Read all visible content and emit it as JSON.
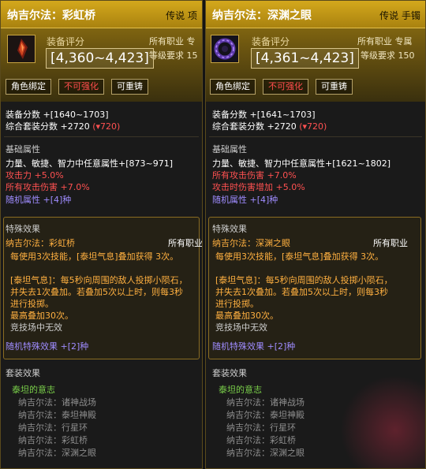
{
  "panel_left": {
    "title": "纳吉尔法：彩虹桥",
    "grade": "传说 项",
    "score_label": "装备评分",
    "score": "[4,360~4,423]",
    "class_req": "所有职业 专",
    "level_req": "等级要求 15",
    "icon": "red-shard-icon",
    "tags": [
      "角色绑定",
      "不可强化",
      "可重铸"
    ],
    "equip_score": "装备分数 +[1640~1703]",
    "set_score_prefix": "综合套装分数 +2720",
    "set_score_delta": "(▾720)",
    "base_attr_title": "基础属性",
    "base_attrs": [
      "力量、敏捷、智力中任意属性+[873~971]",
      "攻击力 +5.0%",
      "所有攻击伤害 +7.0%",
      "随机属性 +[4]种"
    ],
    "special_title": "特殊效果",
    "special_name": "纳吉尔法：彩虹桥",
    "special_class": "所有职业",
    "special_lines": [
      "每使用3次技能，[泰坦气息]叠加获得 3次。",
      "[泰坦气息]：每5秒向周围的敌人投掷小陨石，",
      "并失去1次叠加。若叠加5次以上时，则每3秒",
      "进行投掷。",
      "最高叠加30次。",
      "竞技场中无效"
    ],
    "special_random": "随机特殊效果 +[2]种",
    "set_title": "套装效果",
    "set_name": "泰坦的意志",
    "set_items": [
      "纳吉尔法：诸神战场",
      "纳吉尔法：泰坦神殿",
      "纳吉尔法：行星环",
      "纳吉尔法：彩虹桥",
      "纳吉尔法：深渊之眼"
    ]
  },
  "panel_right": {
    "title": "纳吉尔法：深渊之眼",
    "grade": "传说 手镯",
    "score_label": "装备评分",
    "score": "[4,361~4,423]",
    "class_req": "所有职业 专属",
    "level_req": "等级要求 150",
    "icon": "purple-ring-icon",
    "tags": [
      "角色绑定",
      "不可强化",
      "可重铸"
    ],
    "equip_score": "装备分数 +[1641~1703]",
    "set_score_prefix": "综合套装分数 +2720",
    "set_score_delta": "(▾720)",
    "base_attr_title": "基础属性",
    "base_attrs": [
      "力量、敏捷、智力中任意属性+[1621~1802]",
      "所有攻击伤害 +7.0%",
      "攻击时伤害增加 +5.0%",
      "随机属性 +[4]种"
    ],
    "special_title": "特殊效果",
    "special_name": "纳吉尔法：深渊之眼",
    "special_class": "所有职业",
    "special_lines": [
      "每使用3次技能，[泰坦气息]叠加获得 3次。",
      "[泰坦气息]：每5秒向周围的敌人投掷小陨石，",
      "并失去1次叠加。若叠加5次以上时，则每3秒",
      "进行投掷。",
      "最高叠加30次。",
      "竞技场中无效"
    ],
    "special_random": "随机特殊效果 +[2]种",
    "set_title": "套装效果",
    "set_name": "泰坦的意志",
    "set_items": [
      "纳吉尔法：诸神战场",
      "纳吉尔法：泰坦神殿",
      "纳吉尔法：行星环",
      "纳吉尔法：彩虹桥",
      "纳吉尔法：深渊之眼"
    ]
  },
  "colors": {
    "gold": "#d4a81c",
    "attr_red": "#ff5151",
    "attr_orange": "#ffb040",
    "random_purple": "#9f8cff",
    "set_green": "#7ad04a"
  }
}
